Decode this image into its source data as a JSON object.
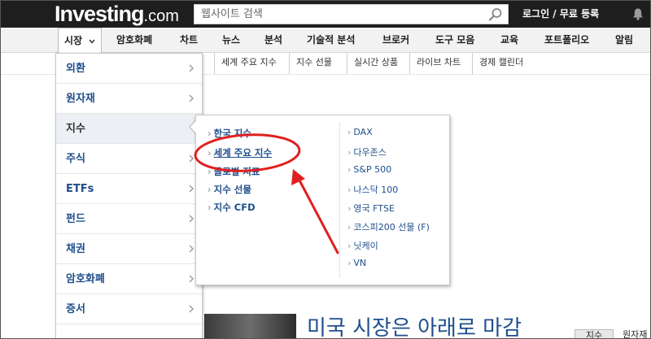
{
  "header": {
    "logo_main": "Investing",
    "logo_suffix": ".com",
    "search_placeholder": "웹사이트 검색",
    "login": "로그인 / 무료 등록"
  },
  "nav": [
    {
      "label": "시장"
    },
    {
      "label": "암호화폐"
    },
    {
      "label": "차트"
    },
    {
      "label": "뉴스"
    },
    {
      "label": "분석"
    },
    {
      "label": "기술적 분석"
    },
    {
      "label": "브로커"
    },
    {
      "label": "도구 모음"
    },
    {
      "label": "교육"
    },
    {
      "label": "포트폴리오"
    },
    {
      "label": "알림"
    }
  ],
  "subnav": [
    "세계 주요 지수",
    "지수 선물",
    "실시간 상품",
    "라이브 차트",
    "경제 캘린더"
  ],
  "menu": [
    {
      "label": "외환"
    },
    {
      "label": "원자재"
    },
    {
      "label": "지수"
    },
    {
      "label": "주식"
    },
    {
      "label": "ETFs"
    },
    {
      "label": "펀드"
    },
    {
      "label": "채권"
    },
    {
      "label": "암호화폐"
    },
    {
      "label": "증서"
    }
  ],
  "submenu_col1": [
    "한국 지수",
    "세계 주요 지수",
    "글로벌 지표",
    "지수 선물",
    "지수 CFD"
  ],
  "submenu_col2": [
    "DAX",
    "다우존스",
    "S&P 500",
    "나스닥 100",
    "영국 FTSE",
    "코스피200 선물 (F)",
    "닛케이",
    "VN"
  ],
  "content": {
    "headline": "미국 시장은 아래로 마감",
    "tab_active": "지수",
    "tab_other": "원자재"
  },
  "colors": {
    "header_bg": "#1e1e1e",
    "link_blue": "#1f4e8c",
    "annotation_red": "#e02020"
  }
}
